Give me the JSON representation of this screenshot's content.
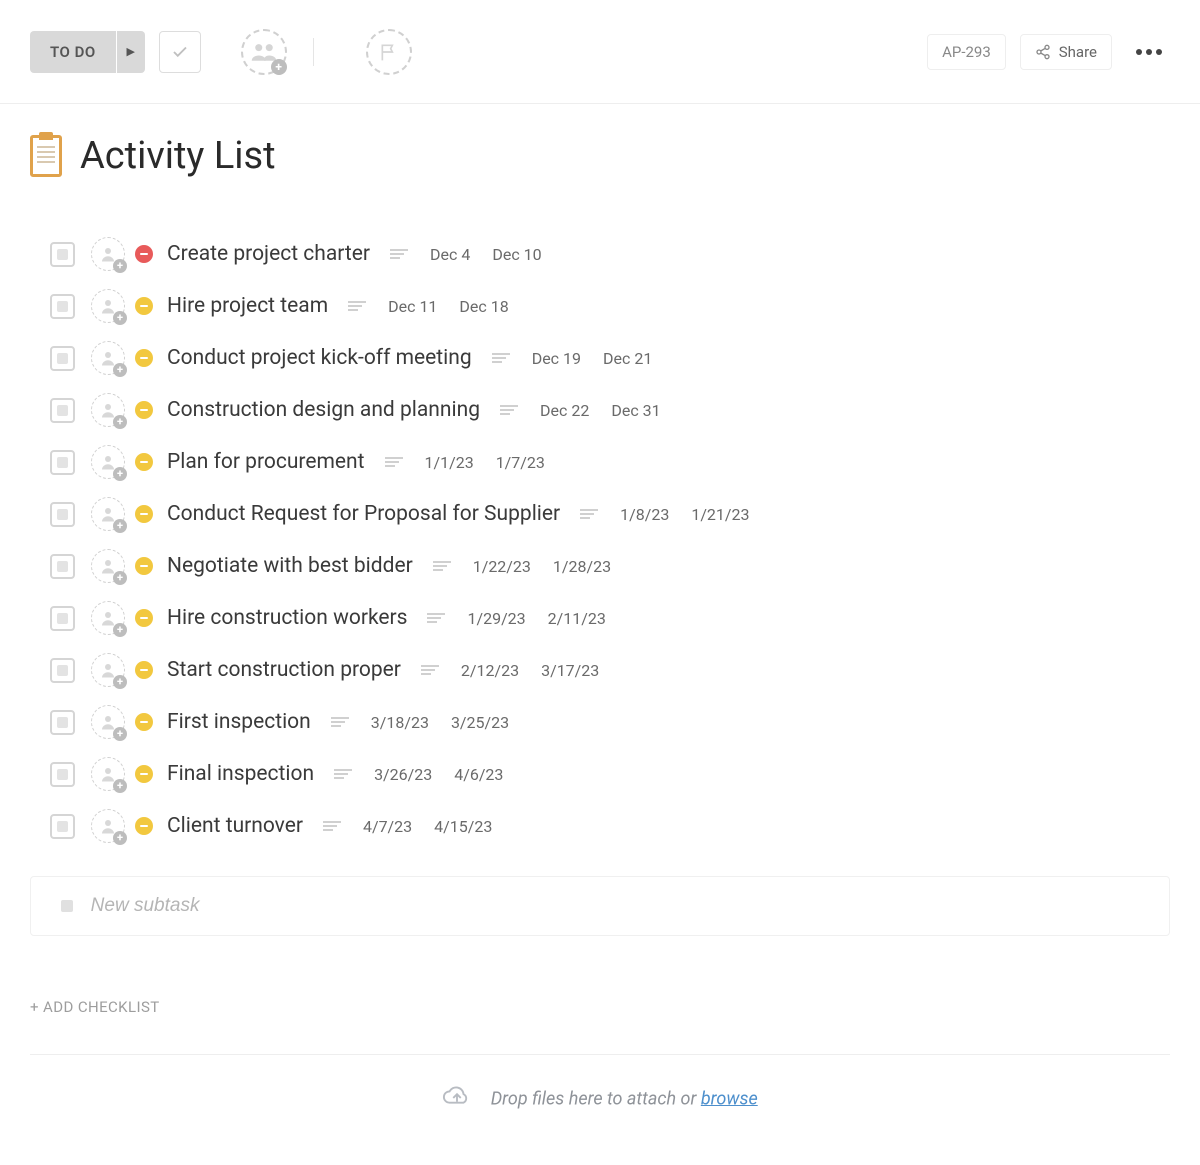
{
  "toolbar": {
    "status_label": "TO DO",
    "task_id": "AP-293",
    "share_label": "Share"
  },
  "page": {
    "title": "Activity List"
  },
  "tasks": [
    {
      "title": "Create project charter",
      "priority": "red",
      "start": "Dec 4",
      "end": "Dec 10"
    },
    {
      "title": "Hire project team",
      "priority": "yellow",
      "start": "Dec 11",
      "end": "Dec 18"
    },
    {
      "title": "Conduct project kick-off meeting",
      "priority": "yellow",
      "start": "Dec 19",
      "end": "Dec 21"
    },
    {
      "title": "Construction design and planning",
      "priority": "yellow",
      "start": "Dec 22",
      "end": "Dec 31"
    },
    {
      "title": "Plan for procurement",
      "priority": "yellow",
      "start": "1/1/23",
      "end": "1/7/23"
    },
    {
      "title": "Conduct Request for Proposal for Supplier",
      "priority": "yellow",
      "start": "1/8/23",
      "end": "1/21/23"
    },
    {
      "title": "Negotiate with best bidder",
      "priority": "yellow",
      "start": "1/22/23",
      "end": "1/28/23"
    },
    {
      "title": "Hire construction workers",
      "priority": "yellow",
      "start": "1/29/23",
      "end": "2/11/23"
    },
    {
      "title": "Start construction proper",
      "priority": "yellow",
      "start": "2/12/23",
      "end": "3/17/23"
    },
    {
      "title": "First inspection",
      "priority": "yellow",
      "start": "3/18/23",
      "end": "3/25/23"
    },
    {
      "title": "Final inspection",
      "priority": "yellow",
      "start": "3/26/23",
      "end": "4/6/23"
    },
    {
      "title": "Client turnover",
      "priority": "yellow",
      "start": "4/7/23",
      "end": "4/15/23"
    }
  ],
  "new_subtask_placeholder": "New subtask",
  "add_checklist_label": "+ ADD CHECKLIST",
  "dropzone": {
    "text": "Drop files here to attach or ",
    "link": "browse"
  }
}
